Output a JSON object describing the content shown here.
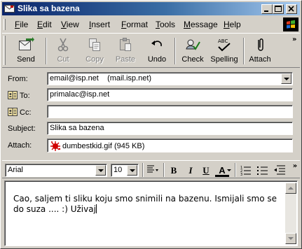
{
  "window": {
    "title": "Slika sa bazena"
  },
  "menu": [
    "File",
    "Edit",
    "View",
    "Insert",
    "Format",
    "Tools",
    "Message",
    "Help"
  ],
  "toolbar": {
    "send": "Send",
    "cut": "Cut",
    "copy": "Copy",
    "paste": "Paste",
    "undo": "Undo",
    "check": "Check",
    "spelling": "Spelling",
    "attach": "Attach",
    "more": "»"
  },
  "headers": {
    "from_label": "From:",
    "from_value": "email@isp.net    (mail.isp.net)",
    "to_label": "To:",
    "to_value": "primalac@isp.net",
    "cc_label": "Cc:",
    "cc_value": "",
    "subject_label": "Subject:",
    "subject_value": "Slika sa bazena",
    "attach_label": "Attach:",
    "attach_value": "dumbestkid.gif (945 KB)"
  },
  "format": {
    "font": "Arial",
    "size": "10",
    "bold": "B",
    "italic": "I",
    "underline": "U",
    "fontcolor": "A",
    "more": "»"
  },
  "body": {
    "line1": "Cao, saljem ti sliku koju smo snimili na bazenu. Ismijali smo se",
    "line2": "do suza .... :) Uživaj"
  },
  "colors": {
    "title_start": "#0a246a",
    "title_end": "#a6caf0",
    "face": "#d4d0c8"
  },
  "icons": [
    "mail-icon",
    "minimize-icon",
    "maximize-icon",
    "close-icon",
    "windows-logo-icon",
    "send-icon",
    "cut-icon",
    "copy-icon",
    "paste-icon",
    "undo-icon",
    "check-icon",
    "spelling-icon",
    "attach-icon",
    "address-book-icon",
    "attachment-file-icon",
    "style-icon",
    "bullets-icon",
    "numbering-icon",
    "decrease-indent-icon"
  ]
}
